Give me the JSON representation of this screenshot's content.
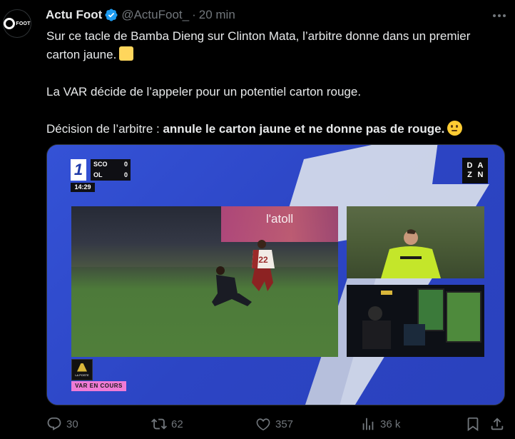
{
  "author": {
    "display_name": "Actu Foot",
    "handle": "@ActuFoot_",
    "separator": "·",
    "time": "20 min",
    "avatar_text": "FOOT"
  },
  "tweet": {
    "line1": "Sur ce tacle de Bamba Dieng sur Clinton Mata, l’arbitre donne dans un premier carton jaune.",
    "line2": "La VAR décide de l’appeler pour un potentiel carton rouge.",
    "line3_prefix": "Décision de l’arbitre : ",
    "line3_bold": "annule le carton jaune et ne donne pas de rouge."
  },
  "media": {
    "scoreboard": {
      "competition_mark": "1",
      "home": {
        "team": "SCO",
        "score": "0"
      },
      "away": {
        "team": "OL",
        "score": "0"
      },
      "clock": "14:29"
    },
    "broadcaster": [
      "D",
      "A",
      "Z",
      "N"
    ],
    "ad_text": "l'atoll",
    "jersey_number": "22",
    "league_label": "LA POSTE",
    "var_tag": "VAR EN COURS"
  },
  "actions": {
    "replies": "30",
    "reposts": "62",
    "likes": "357",
    "views": "36 k"
  },
  "icons": {
    "verified": "verified-badge-icon",
    "more": "more-icon",
    "reply": "reply-icon",
    "repost": "repost-icon",
    "like": "heart-icon",
    "views": "views-icon",
    "bookmark": "bookmark-icon",
    "share": "share-icon"
  },
  "colors": {
    "background": "#000000",
    "text": "#e7e9ea",
    "muted": "#71767b",
    "verified": "#1d9bf0",
    "media_blue": "#2e49c9",
    "var_tag": "#f07bd6"
  }
}
